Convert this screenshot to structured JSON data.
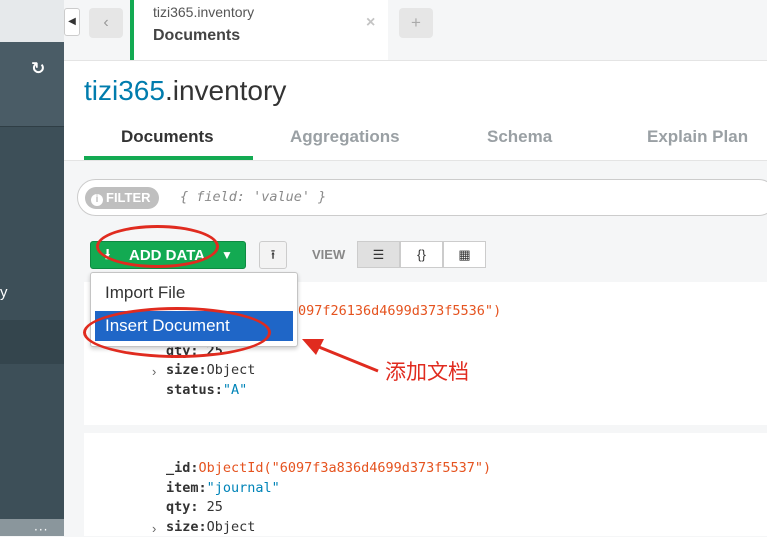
{
  "tab": {
    "namespace": "tizi365.inventory",
    "name": "Documents",
    "close": "×",
    "add": "+",
    "back": "‹",
    "scroll_left": "◀"
  },
  "page": {
    "db": "tizi365",
    "collection": ".inventory"
  },
  "subtabs": [
    {
      "label": "Documents",
      "active": true
    },
    {
      "label": "Aggregations",
      "active": false
    },
    {
      "label": "Schema",
      "active": false
    },
    {
      "label": "Explain Plan",
      "active": false
    }
  ],
  "sidebar": {
    "fragment": "y",
    "dots": "···"
  },
  "filter": {
    "badge": "FILTER",
    "info": "i",
    "placeholder": "{ field: 'value' }"
  },
  "toolbar": {
    "add_data": "ADD DATA",
    "view_label": "VIEW",
    "view_modes": [
      "list",
      "json",
      "table"
    ]
  },
  "dropdown": {
    "items": [
      "Import File",
      "Insert Document"
    ],
    "selected": "Insert Document"
  },
  "documents": [
    {
      "id_fragment": "097f26136d4699d373f5536\")",
      "qty_fragment": "qty: 25",
      "size_key": "size:",
      "size_val": "Object",
      "status_key": "status:",
      "status_val": "\"A\""
    },
    {
      "id_key": "_id:",
      "id_val": "ObjectId(\"6097f3a836d4699d373f5537\")",
      "item_key": "item:",
      "item_val": "\"journal\"",
      "qty_key": "qty:",
      "qty_val": "25",
      "size_key": "size:",
      "size_val": "Object"
    }
  ],
  "annotation": {
    "text": "添加文档",
    "color": "#e02b1f"
  },
  "colors": {
    "accent_green": "#13aa52",
    "selection_blue": "#1f66c7",
    "db_blue": "#007cad",
    "objectid_orange": "#e5531f",
    "string_blue": "#0084b8",
    "sidebar": "#3d4f58"
  }
}
